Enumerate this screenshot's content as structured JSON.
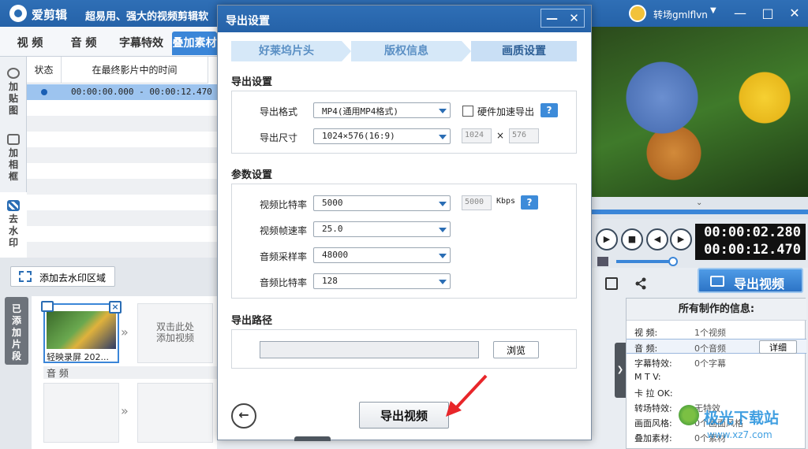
{
  "app": {
    "name": "爱剪辑",
    "slogan": "超易用、强大的视频剪辑软",
    "user": "转场gmlflvn",
    "window_buttons": {
      "minimize": "—",
      "maximize": "□",
      "close": "✕"
    }
  },
  "left_tabs": [
    "视 频",
    "音 频",
    "字幕特效",
    "叠加素材"
  ],
  "side_menu": [
    {
      "label": "加贴图",
      "icon": "sticker-icon"
    },
    {
      "label": "加相框",
      "icon": "frame-icon"
    },
    {
      "label": "去水印",
      "icon": "mosaic-icon"
    }
  ],
  "watermark_list": {
    "headers": [
      "状态",
      "在最终影片中的时间"
    ],
    "rows": [
      {
        "time": "00:00:00.000 - 00:00:12.470"
      }
    ],
    "add_button": "添加去水印区域"
  },
  "clips": {
    "section_label": "已添加片段",
    "clip_name": "轻映录屏 202...",
    "add_hint": "双击此处\n添加视频",
    "audio_label": "音 频"
  },
  "dialog": {
    "title": "导出设置",
    "controls": {
      "minimize": "—",
      "close": "✕"
    },
    "steps": [
      "好莱坞片头",
      "版权信息",
      "画质设置"
    ],
    "export_section": {
      "title": "导出设置",
      "format_label": "导出格式",
      "format_value": "MP4(通用MP4格式)",
      "hw_accel_label": "硬件加速导出",
      "size_label": "导出尺寸",
      "size_value": "1024×576(16:9)",
      "width": "1024",
      "times": "×",
      "height": "576"
    },
    "params_section": {
      "title": "参数设置",
      "video_bitrate_label": "视频比特率",
      "video_bitrate_value": "5000",
      "video_bitrate_readonly": "5000",
      "bitrate_unit": "Kbps",
      "framerate_label": "视频帧速率",
      "framerate_value": "25.0",
      "samplerate_label": "音频采样率",
      "samplerate_value": "48000",
      "audio_bitrate_label": "音频比特率",
      "audio_bitrate_value": "128"
    },
    "path_section": {
      "title": "导出路径",
      "path_value": "",
      "browse_label": "浏览"
    },
    "help_label": "?",
    "back_label": "←",
    "export_label": "导出视频"
  },
  "player": {
    "current_time": "00:00:02.280",
    "total_time": "00:00:12.470",
    "volume": 0.9,
    "buttons": {
      "play": "▶",
      "stop": "■",
      "prev": "◀",
      "next": "▶"
    }
  },
  "export_main_label": "导出视频",
  "info_panel": {
    "title": "所有制作的信息:",
    "rows": [
      {
        "key": "视    频:",
        "value": "1个视频"
      },
      {
        "key": "音    频:",
        "value": "0个音频",
        "action": "详细"
      },
      {
        "key": "字幕特效:",
        "value": "0个字幕"
      },
      {
        "key": "M   T  V:",
        "value": ""
      },
      {
        "key": "卡 拉 OK:",
        "value": ""
      },
      {
        "key": "转场特效:",
        "value": "无特效"
      },
      {
        "key": "画面风格:",
        "value": "0个画面风格"
      },
      {
        "key": "叠加素材:",
        "value": "0个素材"
      }
    ]
  },
  "watermark_site": {
    "name": "极光下载站",
    "url": "www.xz7.com"
  },
  "colors": {
    "title_blue": "#2a68ae",
    "accent_blue": "#3b86d8",
    "step_bg": "#d6e8f8"
  }
}
